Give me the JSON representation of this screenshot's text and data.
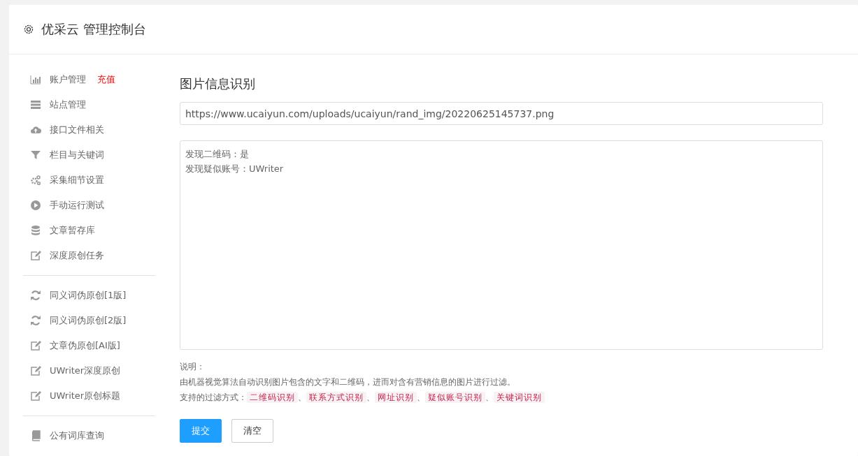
{
  "header": {
    "title": "优采云 管理控制台"
  },
  "sidebar": {
    "groups": [
      {
        "items": [
          {
            "label": "账户管理",
            "badge": "充值"
          },
          {
            "label": "站点管理"
          },
          {
            "label": "接口文件相关"
          },
          {
            "label": "栏目与关键词"
          },
          {
            "label": "采集细节设置"
          },
          {
            "label": "手动运行测试"
          },
          {
            "label": "文章暂存库"
          },
          {
            "label": "深度原创任务"
          }
        ]
      },
      {
        "items": [
          {
            "label": "同义词伪原创[1版]"
          },
          {
            "label": "同义词伪原创[2版]"
          },
          {
            "label": "文章伪原创[AI版]"
          },
          {
            "label": "UWriter深度原创"
          },
          {
            "label": "UWriter原创标题"
          }
        ]
      },
      {
        "items": [
          {
            "label": "公有词库查询"
          }
        ]
      }
    ]
  },
  "main": {
    "title": "图片信息识别",
    "url_field": {
      "value": "https://www.ucaiyun.com/uploads/ucaiyun/rand_img/20220625145737.png"
    },
    "result_box": {
      "lines": [
        "发现二维码：是",
        "发现疑似账号：UWriter"
      ]
    },
    "notes": {
      "heading": "说明：",
      "description": "由机器视觉算法自动识别图片包含的文字和二维码，进而对含有营销信息的图片进行过滤。",
      "methods_label": "支持的过滤方式：",
      "separator": "、",
      "methods": [
        "二维码识别",
        "联系方式识别",
        "网址识别",
        "疑似账号识别",
        "关键词识别"
      ]
    },
    "buttons": [
      {
        "label": "提交",
        "kind": "primary"
      },
      {
        "label": "清空",
        "kind": "default"
      }
    ]
  }
}
